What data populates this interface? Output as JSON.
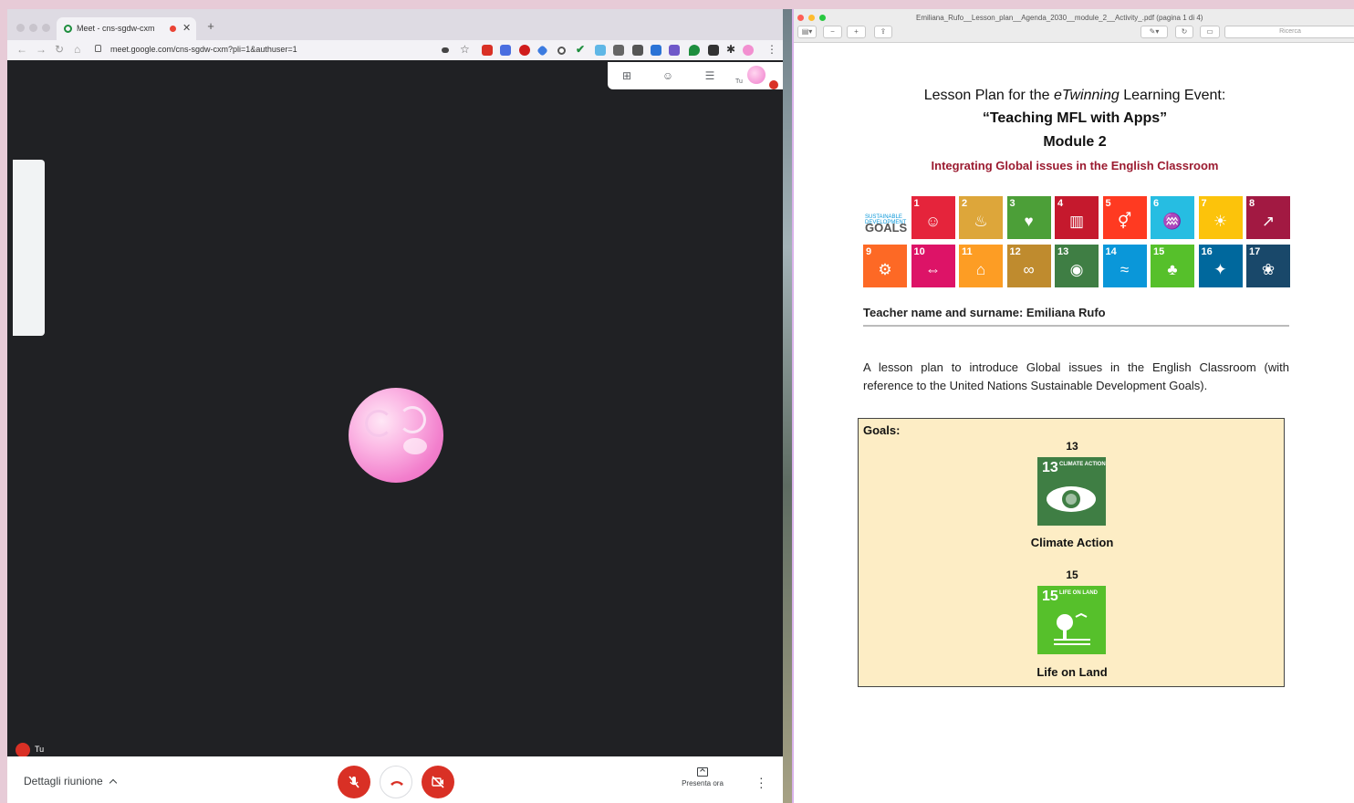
{
  "browser": {
    "tab_title": "Meet - cns-sgdw-cxm",
    "url": "meet.google.com/cns-sgdw-cxm?pli=1&authuser=1"
  },
  "meet": {
    "self_label_top": "Tu",
    "self_label_bottom": "Tu",
    "details_label": "Dettagli riunione",
    "present_label": "Presenta ora",
    "colors": {
      "end_call": "#d93025",
      "stage": "#202124"
    }
  },
  "preview": {
    "window_title": "Emiliana_Rufo__Lesson_plan__Agenda_2030__module_2__Activity_.pdf (pagina 1 di 4)",
    "search_placeholder": "Ricerca"
  },
  "document": {
    "title_pre": "Lesson Plan  for the ",
    "title_em": "eTwinning",
    "title_post": " Learning Event:",
    "subtitle": "“Teaching MFL with Apps”",
    "module": "Module 2",
    "theme": "Integrating Global issues in the English Classroom",
    "sdg_logo_line1": "SUSTAINABLE DEVELOPMENT",
    "sdg_logo_line2": "GOALS",
    "sdg_tiles": [
      {
        "n": "1",
        "color": "#e5243b",
        "glyph": "☺"
      },
      {
        "n": "2",
        "color": "#dda63a",
        "glyph": "♨"
      },
      {
        "n": "3",
        "color": "#4c9f38",
        "glyph": "♥"
      },
      {
        "n": "4",
        "color": "#c5192d",
        "glyph": "▥"
      },
      {
        "n": "5",
        "color": "#ff3a21",
        "glyph": "⚥"
      },
      {
        "n": "6",
        "color": "#26bde2",
        "glyph": "♒"
      },
      {
        "n": "7",
        "color": "#fcc30b",
        "glyph": "☀"
      },
      {
        "n": "8",
        "color": "#a21942",
        "glyph": "↗"
      },
      {
        "n": "9",
        "color": "#fd6925",
        "glyph": "⚙"
      },
      {
        "n": "10",
        "color": "#dd1367",
        "glyph": "⇔"
      },
      {
        "n": "11",
        "color": "#fd9d24",
        "glyph": "⌂"
      },
      {
        "n": "12",
        "color": "#bf8b2e",
        "glyph": "∞"
      },
      {
        "n": "13",
        "color": "#3f7e44",
        "glyph": "◉"
      },
      {
        "n": "14",
        "color": "#0a97d9",
        "glyph": "≈"
      },
      {
        "n": "15",
        "color": "#56c02b",
        "glyph": "♣"
      },
      {
        "n": "16",
        "color": "#00689d",
        "glyph": "✦"
      },
      {
        "n": "17",
        "color": "#19486a",
        "glyph": "❀"
      }
    ],
    "teacher": "Teacher name and surname: Emiliana Rufo",
    "intro": "A lesson plan to introduce Global issues in the English Classroom (with reference to the United Nations Sustainable Development Goals).",
    "goals_label": "Goals:",
    "goals": [
      {
        "number": "13",
        "tile_num": "13",
        "tile_sub": "CLIMATE ACTION",
        "name": "Climate Action",
        "color": "#3f7e44"
      },
      {
        "number": "15",
        "tile_num": "15",
        "tile_sub": "LIFE ON LAND",
        "name": "Life on Land",
        "color": "#56c02b"
      }
    ]
  }
}
